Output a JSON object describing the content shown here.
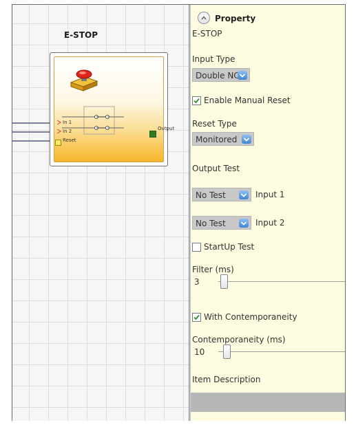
{
  "block": {
    "title": "E-STOP",
    "inputs": [
      "In 1",
      "In 2"
    ],
    "reset_label": "Reset",
    "output_label": "Output"
  },
  "panel": {
    "header_title": "Property",
    "component_name": "E-STOP",
    "input_type": {
      "label": "Input Type",
      "value": "Double NC"
    },
    "enable_manual_reset": {
      "label": "Enable Manual Reset",
      "checked": true
    },
    "reset_type": {
      "label": "Reset Type",
      "value": "Monitored"
    },
    "output_test": {
      "label": "Output Test",
      "rows": [
        {
          "value": "No Test",
          "label": "Input 1"
        },
        {
          "value": "No Test",
          "label": "Input 2"
        }
      ]
    },
    "startup_test": {
      "label": "StartUp Test",
      "checked": false
    },
    "filter": {
      "label": "Filter (ms)",
      "value": "3"
    },
    "with_contemporaneity": {
      "label": "With Contemporaneity",
      "checked": true
    },
    "contemporaneity": {
      "label": "Contemporaneity (ms)",
      "value": "10"
    },
    "item_description": {
      "label": "Item Description",
      "value": ""
    }
  },
  "colors": {
    "panel_bg": "#fdfbe0",
    "dropdown_chevron": "#3f84d6",
    "output_port": "#2e7d1f"
  }
}
